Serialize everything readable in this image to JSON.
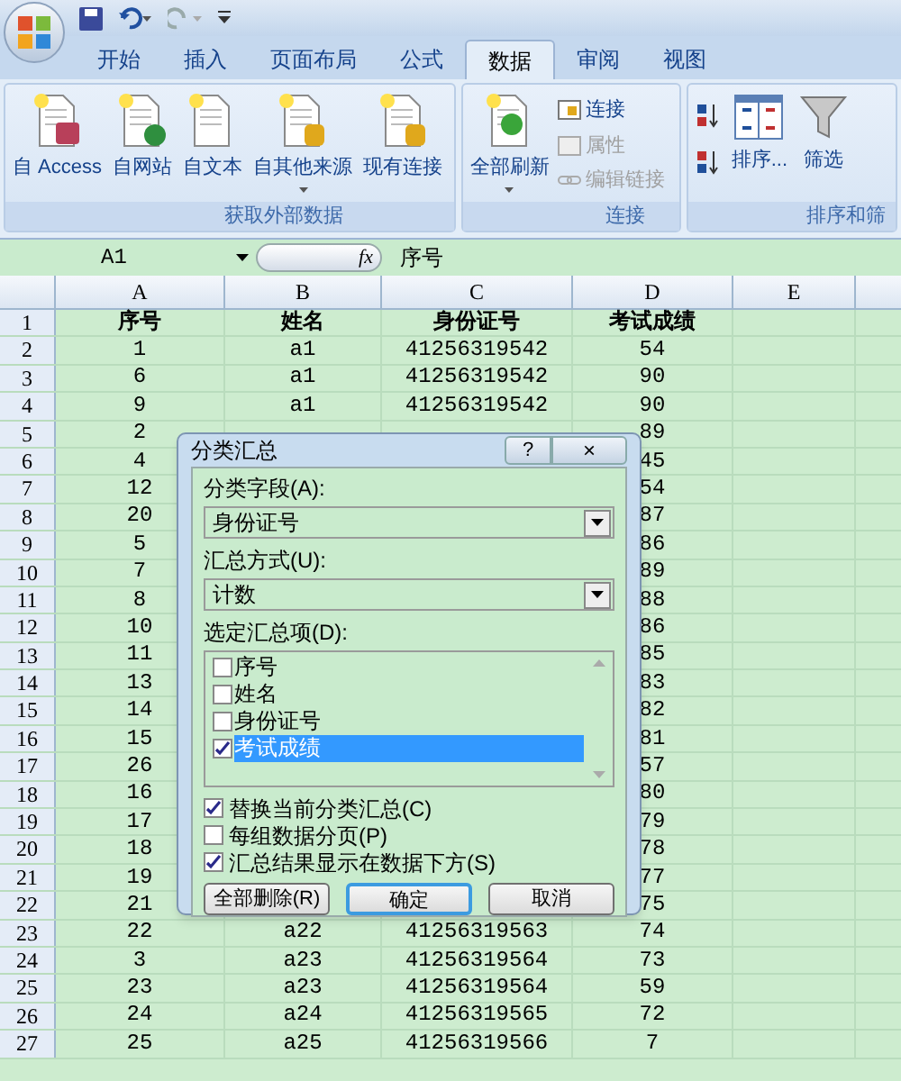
{
  "tabs": [
    {
      "label": "开始",
      "selected": false
    },
    {
      "label": "插入",
      "selected": false
    },
    {
      "label": "页面布局",
      "selected": false
    },
    {
      "label": "公式",
      "selected": false
    },
    {
      "label": "数据",
      "selected": true
    },
    {
      "label": "审阅",
      "selected": false
    },
    {
      "label": "视图",
      "selected": false
    }
  ],
  "ribbon": {
    "groups": [
      {
        "label": "获取外部数据",
        "buttons": [
          {
            "kind": "large",
            "label": "自 Access",
            "disabled": false,
            "dropdown": false
          },
          {
            "kind": "large",
            "label": "自网站",
            "disabled": false,
            "dropdown": false
          },
          {
            "kind": "large",
            "label": "自文本",
            "disabled": false,
            "dropdown": false
          },
          {
            "kind": "large",
            "label": "自其他来源",
            "disabled": false,
            "dropdown": true
          },
          {
            "kind": "large",
            "label": "现有连接",
            "disabled": false,
            "dropdown": false
          }
        ]
      },
      {
        "label": "连接",
        "buttons": [
          {
            "kind": "large",
            "label": "全部刷新",
            "disabled": false,
            "dropdown": true
          },
          {
            "kind": "small",
            "label": "连接",
            "disabled": false
          },
          {
            "kind": "small",
            "label": "属性",
            "disabled": true
          },
          {
            "kind": "small",
            "label": "编辑链接",
            "disabled": true
          }
        ]
      },
      {
        "label": "排序和筛",
        "buttons": [
          {
            "kind": "sortpair",
            "disabled": false
          },
          {
            "kind": "large",
            "label": "排序...",
            "disabled": false,
            "dropdown": false
          },
          {
            "kind": "large",
            "label": "筛选",
            "disabled": false,
            "dropdown": false
          }
        ]
      }
    ]
  },
  "formula_bar": {
    "name_box": "A1",
    "fx": "fx",
    "content": "序号"
  },
  "columns": [
    "A",
    "B",
    "C",
    "D",
    "E"
  ],
  "rows": [
    {
      "header": "1",
      "cells": [
        "序号",
        "姓名",
        "身份证号",
        "考试成绩"
      ]
    },
    {
      "header": "2",
      "cells": [
        "1",
        "a1",
        "41256319542",
        "54"
      ]
    },
    {
      "header": "3",
      "cells": [
        "6",
        "a1",
        "41256319542",
        "90"
      ]
    },
    {
      "header": "4",
      "cells": [
        "9",
        "a1",
        "41256319542",
        "90"
      ]
    },
    {
      "header": "5",
      "cells": [
        "2",
        "",
        "",
        "89"
      ]
    },
    {
      "header": "6",
      "cells": [
        "4",
        "",
        "",
        "45"
      ]
    },
    {
      "header": "7",
      "cells": [
        "12",
        "",
        "",
        "54"
      ]
    },
    {
      "header": "8",
      "cells": [
        "20",
        "",
        "",
        "87"
      ]
    },
    {
      "header": "9",
      "cells": [
        "5",
        "",
        "",
        "86"
      ]
    },
    {
      "header": "10",
      "cells": [
        "7",
        "",
        "",
        "89"
      ]
    },
    {
      "header": "11",
      "cells": [
        "8",
        "",
        "",
        "88"
      ]
    },
    {
      "header": "12",
      "cells": [
        "10",
        "",
        "",
        "86"
      ]
    },
    {
      "header": "13",
      "cells": [
        "11",
        "",
        "",
        "85"
      ]
    },
    {
      "header": "14",
      "cells": [
        "13",
        "",
        "",
        "83"
      ]
    },
    {
      "header": "15",
      "cells": [
        "14",
        "",
        "",
        "82"
      ]
    },
    {
      "header": "16",
      "cells": [
        "15",
        "",
        "",
        "81"
      ]
    },
    {
      "header": "17",
      "cells": [
        "26",
        "",
        "",
        "57"
      ]
    },
    {
      "header": "18",
      "cells": [
        "16",
        "",
        "",
        "80"
      ]
    },
    {
      "header": "19",
      "cells": [
        "17",
        "",
        "",
        "79"
      ]
    },
    {
      "header": "20",
      "cells": [
        "18",
        "",
        "",
        "78"
      ]
    },
    {
      "header": "21",
      "cells": [
        "19",
        "",
        "",
        "77"
      ]
    },
    {
      "header": "22",
      "cells": [
        "21",
        "",
        "",
        "75"
      ]
    },
    {
      "header": "23",
      "cells": [
        "22",
        "a22",
        "41256319563",
        "74"
      ]
    },
    {
      "header": "24",
      "cells": [
        "3",
        "a23",
        "41256319564",
        "73"
      ]
    },
    {
      "header": "25",
      "cells": [
        "23",
        "a23",
        "41256319564",
        "59"
      ]
    },
    {
      "header": "26",
      "cells": [
        "24",
        "a24",
        "41256319565",
        "72"
      ]
    },
    {
      "header": "27",
      "cells": [
        "25",
        "a25",
        "41256319566",
        "7"
      ]
    }
  ],
  "dialog": {
    "title": "分类汇总",
    "help": "?",
    "close": "×",
    "group_field": {
      "label": "分类字段(A):",
      "value": "身份证号"
    },
    "method": {
      "label": "汇总方式(U):",
      "value": "计数"
    },
    "items_label": "选定汇总项(D):",
    "items": [
      {
        "label": "序号",
        "checked": false,
        "selected": false
      },
      {
        "label": "姓名",
        "checked": false,
        "selected": false
      },
      {
        "label": "身份证号",
        "checked": false,
        "selected": false
      },
      {
        "label": "考试成绩",
        "checked": true,
        "selected": true
      }
    ],
    "options": [
      {
        "label": "替换当前分类汇总(C)",
        "checked": true
      },
      {
        "label": "每组数据分页(P)",
        "checked": false
      },
      {
        "label": "汇总结果显示在数据下方(S)",
        "checked": true
      }
    ],
    "buttons": [
      {
        "label": "全部删除(R)",
        "default": false
      },
      {
        "label": "确定",
        "default": true
      },
      {
        "label": "取消",
        "default": false
      }
    ]
  }
}
